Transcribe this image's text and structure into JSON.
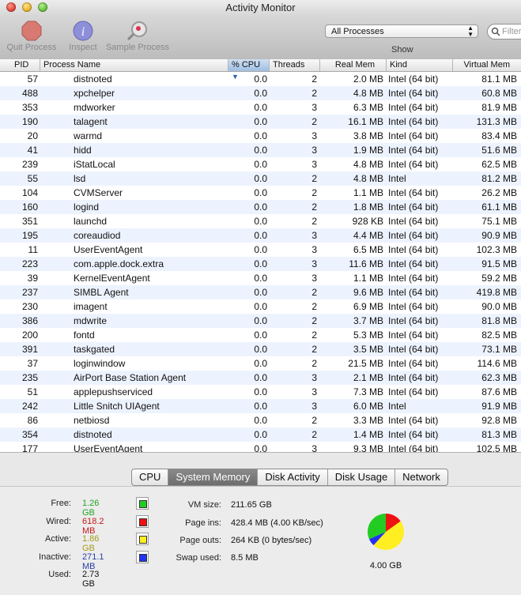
{
  "window": {
    "title": "Activity Monitor"
  },
  "toolbar": {
    "quit_label": "Quit Process",
    "inspect_label": "Inspect",
    "sample_label": "Sample Process",
    "filter_value": "All Processes",
    "show_label": "Show",
    "search_placeholder": "Filter"
  },
  "table": {
    "columns": [
      "PID",
      "Process Name",
      "% CPU",
      "Threads",
      "Real Mem",
      "Kind",
      "Virtual Mem"
    ],
    "sorted_column": "% CPU",
    "rows": [
      [
        "57",
        "distnoted",
        "0.0",
        "2",
        "2.0 MB",
        "Intel (64 bit)",
        "81.1 MB"
      ],
      [
        "488",
        "xpchelper",
        "0.0",
        "2",
        "4.8 MB",
        "Intel (64 bit)",
        "60.8 MB"
      ],
      [
        "353",
        "mdworker",
        "0.0",
        "3",
        "6.3 MB",
        "Intel (64 bit)",
        "81.9 MB"
      ],
      [
        "190",
        "talagent",
        "0.0",
        "2",
        "16.1 MB",
        "Intel (64 bit)",
        "131.3 MB"
      ],
      [
        "20",
        "warmd",
        "0.0",
        "3",
        "3.8 MB",
        "Intel (64 bit)",
        "83.4 MB"
      ],
      [
        "41",
        "hidd",
        "0.0",
        "3",
        "1.9 MB",
        "Intel (64 bit)",
        "51.6 MB"
      ],
      [
        "239",
        "iStatLocal",
        "0.0",
        "3",
        "4.8 MB",
        "Intel (64 bit)",
        "62.5 MB"
      ],
      [
        "55",
        "lsd",
        "0.0",
        "2",
        "4.8 MB",
        "Intel",
        "81.2 MB"
      ],
      [
        "104",
        "CVMServer",
        "0.0",
        "2",
        "1.1 MB",
        "Intel (64 bit)",
        "26.2 MB"
      ],
      [
        "160",
        "logind",
        "0.0",
        "2",
        "1.8 MB",
        "Intel (64 bit)",
        "61.1 MB"
      ],
      [
        "351",
        "launchd",
        "0.0",
        "2",
        "928 KB",
        "Intel (64 bit)",
        "75.1 MB"
      ],
      [
        "195",
        "coreaudiod",
        "0.0",
        "3",
        "4.4 MB",
        "Intel (64 bit)",
        "90.9 MB"
      ],
      [
        "11",
        "UserEventAgent",
        "0.0",
        "3",
        "6.5 MB",
        "Intel (64 bit)",
        "102.3 MB"
      ],
      [
        "223",
        "com.apple.dock.extra",
        "0.0",
        "3",
        "11.6 MB",
        "Intel (64 bit)",
        "91.5 MB"
      ],
      [
        "39",
        "KernelEventAgent",
        "0.0",
        "3",
        "1.1 MB",
        "Intel (64 bit)",
        "59.2 MB"
      ],
      [
        "237",
        "SIMBL Agent",
        "0.0",
        "2",
        "9.6 MB",
        "Intel (64 bit)",
        "419.8 MB"
      ],
      [
        "230",
        "imagent",
        "0.0",
        "2",
        "6.9 MB",
        "Intel (64 bit)",
        "90.0 MB"
      ],
      [
        "386",
        "mdwrite",
        "0.0",
        "2",
        "3.7 MB",
        "Intel (64 bit)",
        "81.8 MB"
      ],
      [
        "200",
        "fontd",
        "0.0",
        "2",
        "5.3 MB",
        "Intel (64 bit)",
        "82.5 MB"
      ],
      [
        "391",
        "taskgated",
        "0.0",
        "2",
        "3.5 MB",
        "Intel (64 bit)",
        "73.1 MB"
      ],
      [
        "37",
        "loginwindow",
        "0.0",
        "2",
        "21.5 MB",
        "Intel (64 bit)",
        "114.6 MB"
      ],
      [
        "235",
        "AirPort Base Station Agent",
        "0.0",
        "3",
        "2.1 MB",
        "Intel (64 bit)",
        "62.3 MB"
      ],
      [
        "51",
        "applepushserviced",
        "0.0",
        "3",
        "7.3 MB",
        "Intel (64 bit)",
        "87.6 MB"
      ],
      [
        "242",
        "Little Snitch UIAgent",
        "0.0",
        "3",
        "6.0 MB",
        "Intel",
        "91.9 MB"
      ],
      [
        "86",
        "netbiosd",
        "0.0",
        "2",
        "3.3 MB",
        "Intel (64 bit)",
        "92.8 MB"
      ],
      [
        "354",
        "distnoted",
        "0.0",
        "2",
        "1.4 MB",
        "Intel (64 bit)",
        "81.3 MB"
      ],
      [
        "177",
        "UserEventAgent",
        "0.0",
        "3",
        "9.3 MB",
        "Intel (64 bit)",
        "102.5 MB"
      ]
    ]
  },
  "tabs": [
    "CPU",
    "System Memory",
    "Disk Activity",
    "Disk Usage",
    "Network"
  ],
  "active_tab": "System Memory",
  "memory": {
    "free": {
      "label": "Free:",
      "value": "1.26 GB",
      "color": "#1fa51f",
      "swatch": "#22cc22"
    },
    "wired": {
      "label": "Wired:",
      "value": "618.2 MB",
      "color": "#c41a1a",
      "swatch": "#ee1111"
    },
    "active": {
      "label": "Active:",
      "value": "1.86 GB",
      "color": "#a39b1a",
      "swatch": "#ffee22"
    },
    "inactive": {
      "label": "Inactive:",
      "value": "271.1 MB",
      "color": "#2a3fa8",
      "swatch": "#2233ee"
    },
    "used": {
      "label": "Used:",
      "value": "2.73 GB"
    }
  },
  "stats": {
    "vm_size": {
      "label": "VM size:",
      "value": "211.65 GB"
    },
    "page_ins": {
      "label": "Page ins:",
      "value": "428.4 MB (4.00 KB/sec)"
    },
    "page_outs": {
      "label": "Page outs:",
      "value": "264 KB (0 bytes/sec)"
    },
    "swap_used": {
      "label": "Swap used:",
      "value": "8.5 MB"
    }
  },
  "pie": {
    "total": "4.00 GB",
    "free_gb": 1.26,
    "wired_gb": 0.6037,
    "active_gb": 1.86,
    "inactive_gb": 0.2647
  }
}
